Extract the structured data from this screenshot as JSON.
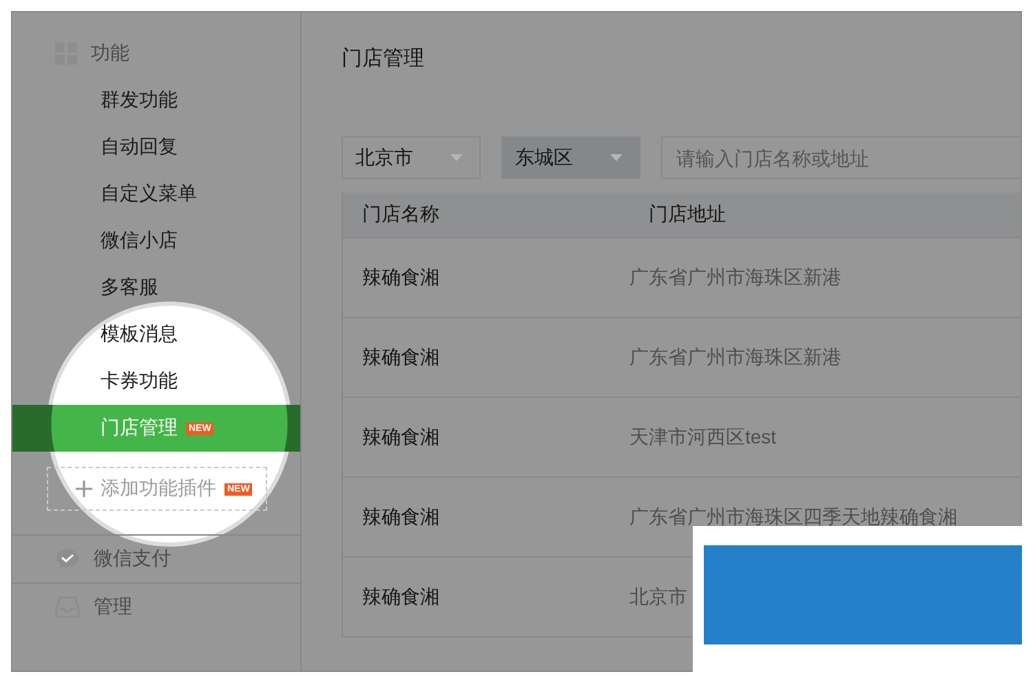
{
  "sidebar": {
    "sections": [
      {
        "kind": "apps",
        "label": "功能",
        "items": [
          {
            "label": "群发功能",
            "selected": false
          },
          {
            "label": "自动回复",
            "selected": false
          },
          {
            "label": "自定义菜单",
            "selected": false
          },
          {
            "label": "微信小店",
            "selected": false
          },
          {
            "label": "多客服",
            "selected": false
          },
          {
            "label": "模板消息",
            "selected": false
          },
          {
            "label": "卡券功能",
            "selected": false
          },
          {
            "label": "门店管理",
            "selected": true,
            "badge": "NEW"
          }
        ],
        "add_plugin": {
          "label": "添加功能插件",
          "badge": "NEW"
        }
      },
      {
        "kind": "pay",
        "label": "微信支付"
      },
      {
        "kind": "inbox",
        "label": "管理"
      }
    ]
  },
  "main": {
    "title": "门店管理",
    "filters": [
      {
        "value": "北京市",
        "active": false
      },
      {
        "value": "东城区",
        "active": true
      }
    ],
    "search": {
      "placeholder": "请输入门店名称或地址"
    },
    "table": {
      "columns": [
        "门店名称",
        "门店地址"
      ],
      "rows": [
        [
          "辣确食湘",
          "广东省广州市海珠区新港"
        ],
        [
          "辣确食湘",
          "广东省广州市海珠区新港"
        ],
        [
          "辣确食湘",
          "天津市河西区test"
        ],
        [
          "辣确食湘",
          "广东省广州市海珠区四季天地辣确食湘"
        ],
        [
          "辣确食湘",
          "北京市"
        ]
      ]
    }
  }
}
